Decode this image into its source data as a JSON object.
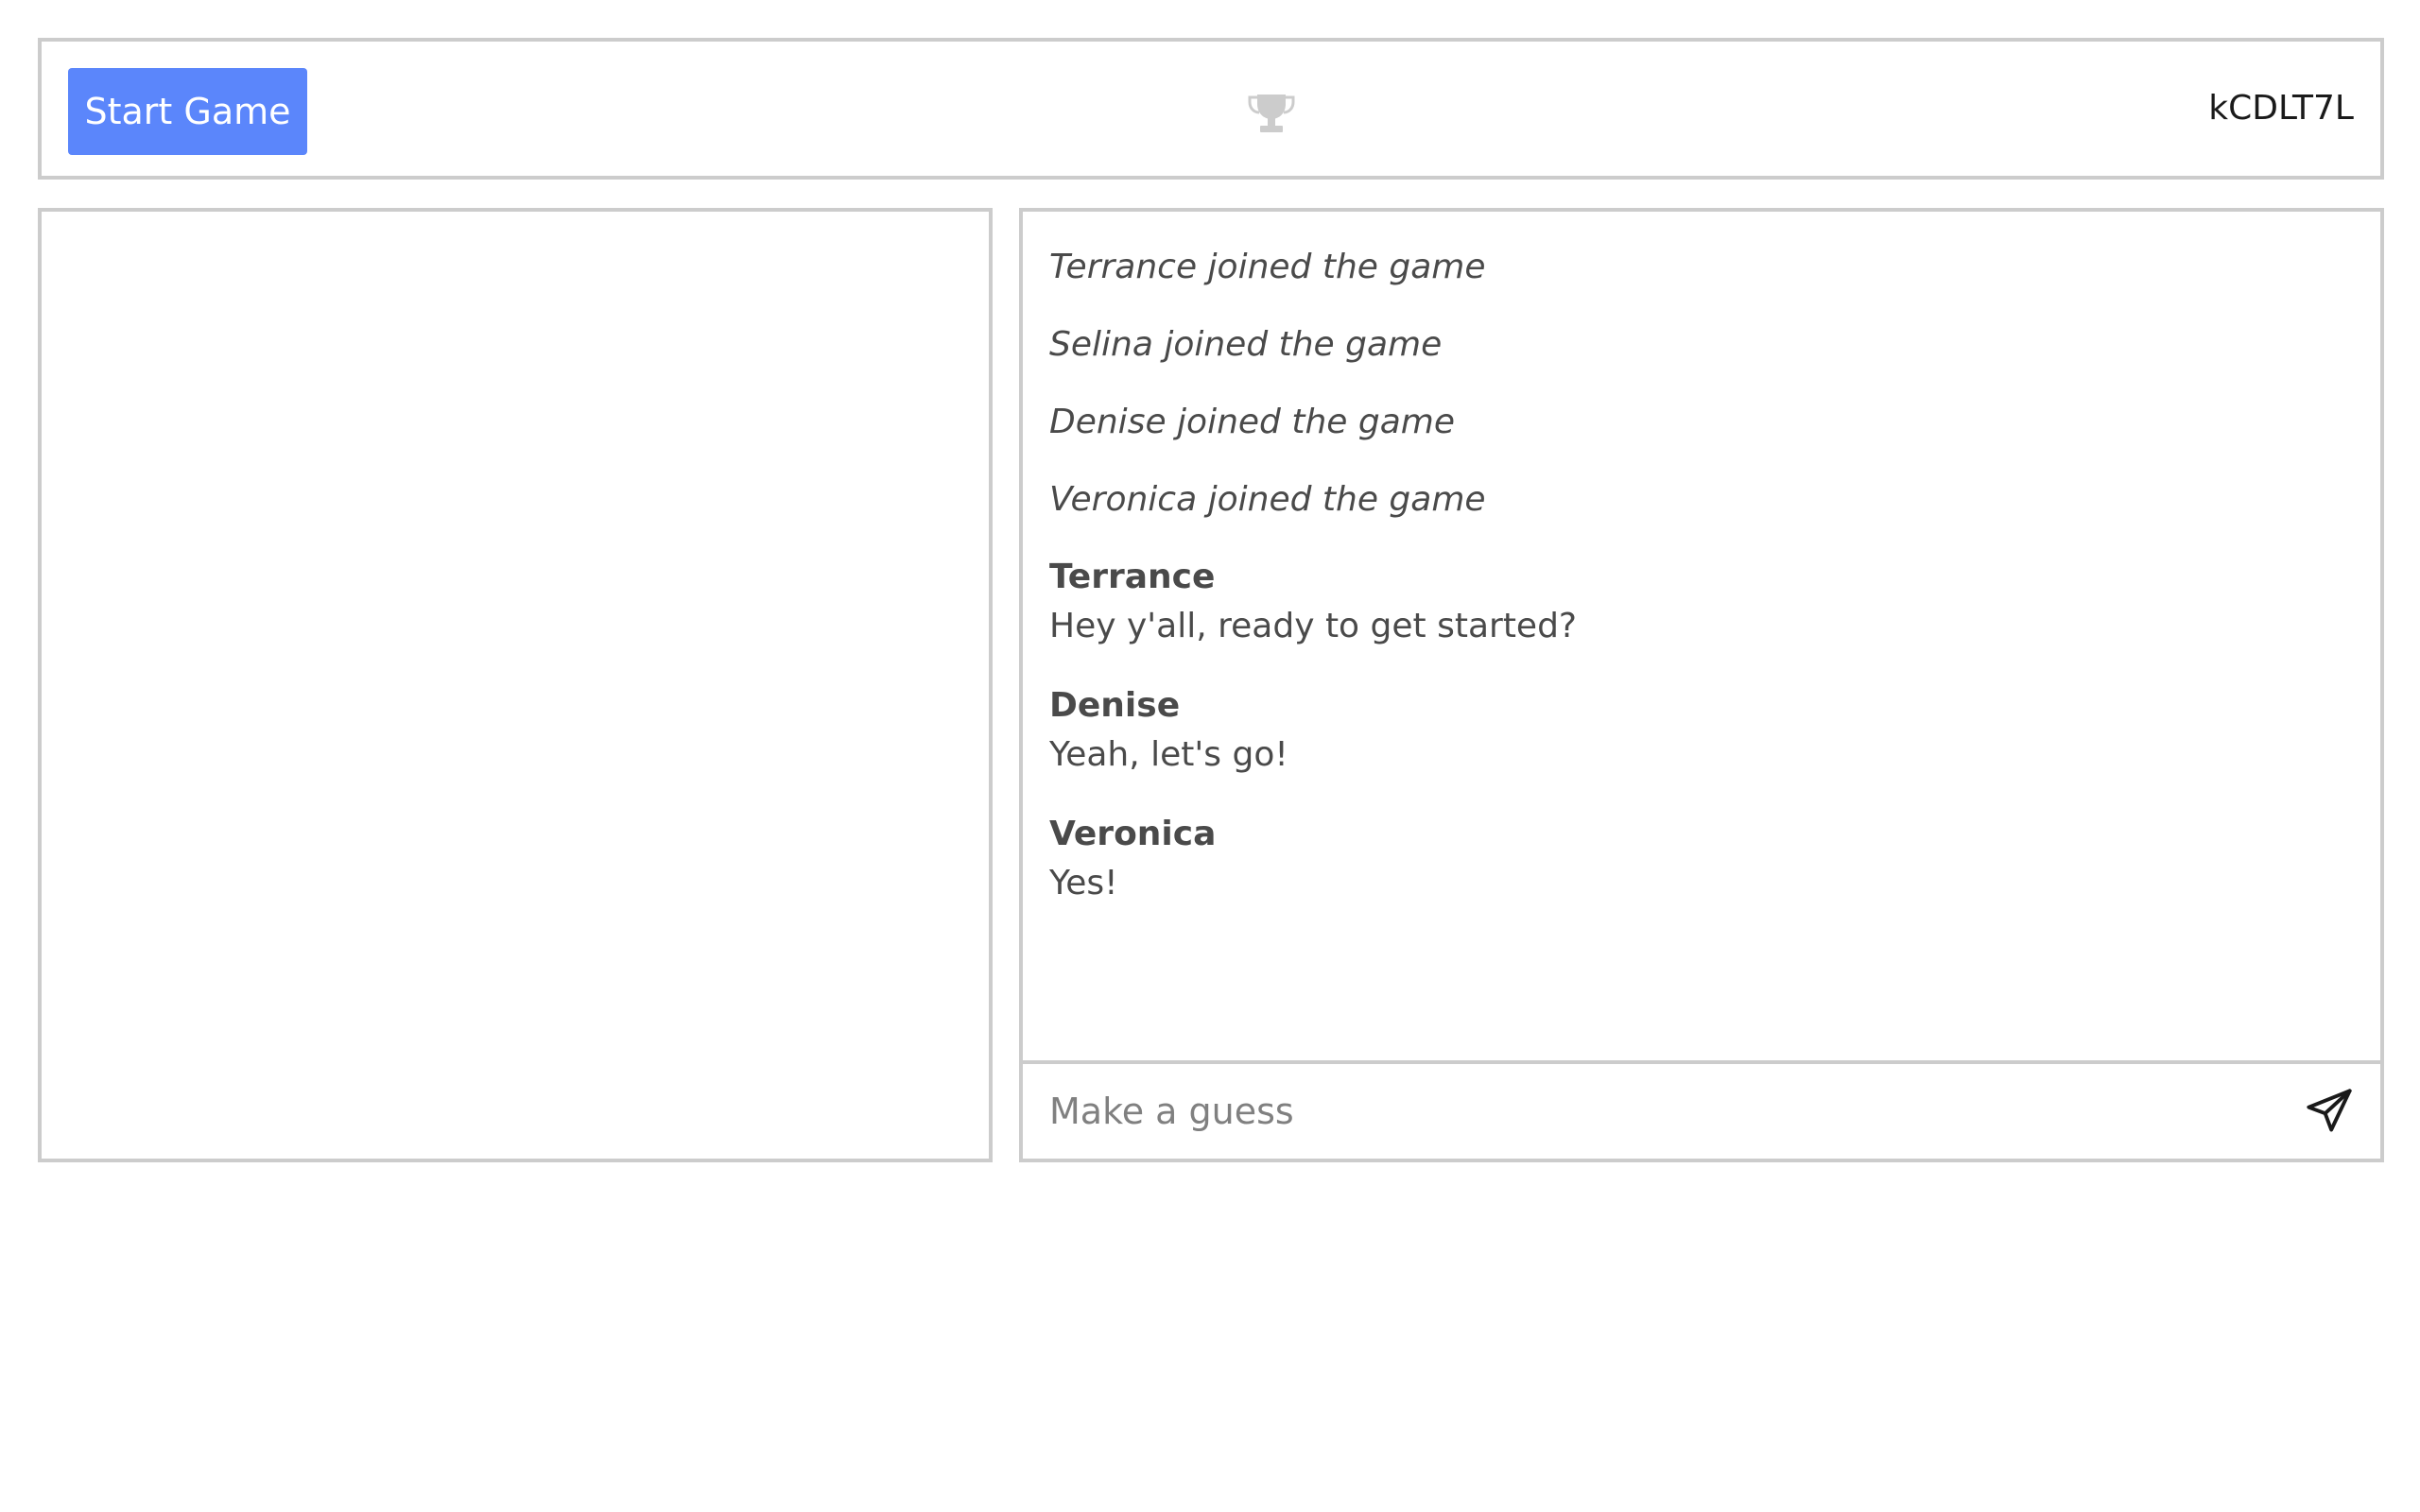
{
  "header": {
    "start_label": "Start Game",
    "room_code": "kCDLT7L",
    "leaderboard_icon": "trophy-icon"
  },
  "chat": {
    "system_messages": [
      "Terrance joined the game",
      "Selina joined the game",
      "Denise joined the game",
      "Veronica joined the game"
    ],
    "messages": [
      {
        "author": "Terrance",
        "text": "Hey y'all, ready to get started?"
      },
      {
        "author": "Denise",
        "text": "Yeah, let's go!"
      },
      {
        "author": "Veronica",
        "text": "Yes!"
      }
    ],
    "input_placeholder": "Make a guess",
    "send_icon": "send-icon"
  },
  "colors": {
    "accent": "#5b86fb",
    "border": "#cccccc",
    "text": "#4a4a4a",
    "icon_muted": "#cccccc"
  }
}
